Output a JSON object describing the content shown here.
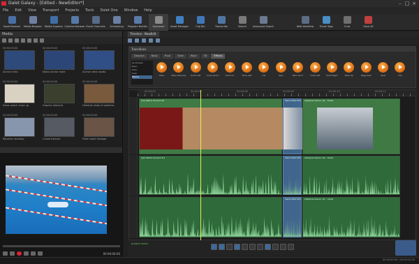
{
  "title_bar": {
    "app_title": "Dalet Galaxy - [Edited - NewEditor*]"
  },
  "menu": [
    "File",
    "Edit",
    "View",
    "Transport",
    "Projects",
    "Tools",
    "Dalet One",
    "Window",
    "Help"
  ],
  "toolbar": [
    {
      "label": "Asset Browser",
      "icon": "asset-icon",
      "color": "#4a6fa5"
    },
    {
      "label": "Media Browser",
      "icon": "media-icon",
      "color": "#6f7fa0"
    },
    {
      "label": "Media Explorer",
      "icon": "explorer-icon",
      "color": "#3f6ea5"
    },
    {
      "label": "Content Browser",
      "icon": "content-icon",
      "color": "#567aa8"
    },
    {
      "label": "Event Channels",
      "icon": "event-icon",
      "color": "#5a6a8a"
    },
    {
      "label": "Scheduling",
      "icon": "schedule-icon",
      "color": "#6b7fa3"
    },
    {
      "label": "Program Builder",
      "icon": "program-icon",
      "color": "#5b79a8"
    },
    {
      "label": "Voiceover",
      "icon": "voice-icon",
      "color": "#8a8a8a",
      "active": true
    },
    {
      "label": "Asset Manager",
      "icon": "manager-icon",
      "color": "#3f7fc1"
    },
    {
      "label": "Clip Bin",
      "icon": "clip-icon",
      "color": "#3f78b8"
    },
    {
      "label": "Transcribe",
      "icon": "transcribe-icon",
      "color": "#5076a3"
    },
    {
      "label": "Search",
      "icon": "search-icon",
      "color": "#7a7a7a"
    },
    {
      "label": "Advanced Search",
      "icon": "advsearch-icon",
      "color": "#6b7a90"
    },
    {
      "label": "",
      "icon": "blank-icon",
      "color": "#2a2a2a"
    },
    {
      "label": "Web Workflow",
      "icon": "workflow-icon",
      "color": "#5d6d86"
    },
    {
      "label": "Ticket Tags",
      "icon": "tag-icon",
      "color": "#4a8fc4"
    },
    {
      "label": "Chat",
      "icon": "chat-icon",
      "color": "#6f6f6f"
    },
    {
      "label": "Close All",
      "icon": "close-icon",
      "color": "#c04040"
    }
  ],
  "media_panel": {
    "header": "Media",
    "items": [
      {
        "top": "00:00:00:00",
        "caption": "Anchor intro",
        "color": "#2d4a7a"
      },
      {
        "top": "00:00:00:00",
        "caption": "News anchor male",
        "color": "#2c4777"
      },
      {
        "top": "00:00:00:00",
        "caption": "Anchor desk studio",
        "color": "#2f4f86"
      },
      {
        "top": "00:00:00:00",
        "caption": "Swiss watch close up",
        "color": "#d9d2c3"
      },
      {
        "top": "00:00:00:00",
        "caption": "Graphic element",
        "color": "#3a3f2e"
      },
      {
        "top": "00:00:00:00",
        "caption": "Lifestyle shots of watches",
        "color": "#7a5a3d"
      },
      {
        "top": "00:00:00:00",
        "caption": "Reporter standup",
        "color": "#8795ad"
      },
      {
        "top": "00:00:00:00",
        "caption": "Crowd exterior",
        "color": "#555a63"
      },
      {
        "top": "00:00:00:00",
        "caption": "Field report footage",
        "color": "#6a5445"
      }
    ]
  },
  "preview": {
    "timecode": "00:00:00:00"
  },
  "timeline_tab": "Timeline - NewEdit",
  "transitions": {
    "title": "Transitions",
    "categories": [
      "Dissolve",
      "Basic",
      "Push",
      "Slide",
      "Wipe",
      "3D",
      "Effects"
    ],
    "active_category": "Effects",
    "list": [
      "All Presets",
      "Basic",
      "Fade",
      "Push",
      "Effects"
    ],
    "selected_list": "Effects",
    "effects": [
      "Fade",
      "Wipe Dissolve",
      "Push Left",
      "Cross Zoom",
      "Zoom In",
      "Slide Left",
      "Iris",
      "Spin",
      "Barn Door",
      "Cube Left",
      "Push Right",
      "Slide Up",
      "Page Peel",
      "Split",
      "Flip"
    ]
  },
  "timeline": {
    "ruler_labels": [
      "00:00:02",
      "00:00:04",
      "00:00:06",
      "00:00:08",
      "00:00:10",
      "00:00:12"
    ],
    "video_clips": [
      {
        "name": "Clip Watch Product #1",
        "color": "#3f7a45"
      },
      {
        "name": "Swiss Watch#1",
        "color": "#41668d"
      },
      {
        "name": "Lifestyle Interior #1 - Shots",
        "color": "#3f7a45"
      }
    ],
    "audio1": [
      {
        "name": "Lyfe Watch Product #1",
        "sel": false
      },
      {
        "name": "Swiss Watch#1",
        "sel": true
      },
      {
        "name": "Lifestyle Interior #1 - Shots",
        "sel": false
      }
    ],
    "audio2": [
      {
        "name": "",
        "sel": false
      },
      {
        "name": "Swiss Watch#1",
        "sel": true
      },
      {
        "name": "Lifestyle Interior #1 - Shots",
        "sel": false
      }
    ]
  },
  "bottom": {
    "status": "project saved",
    "right_status": "00:00:00:00 / 00:00:12:00"
  }
}
